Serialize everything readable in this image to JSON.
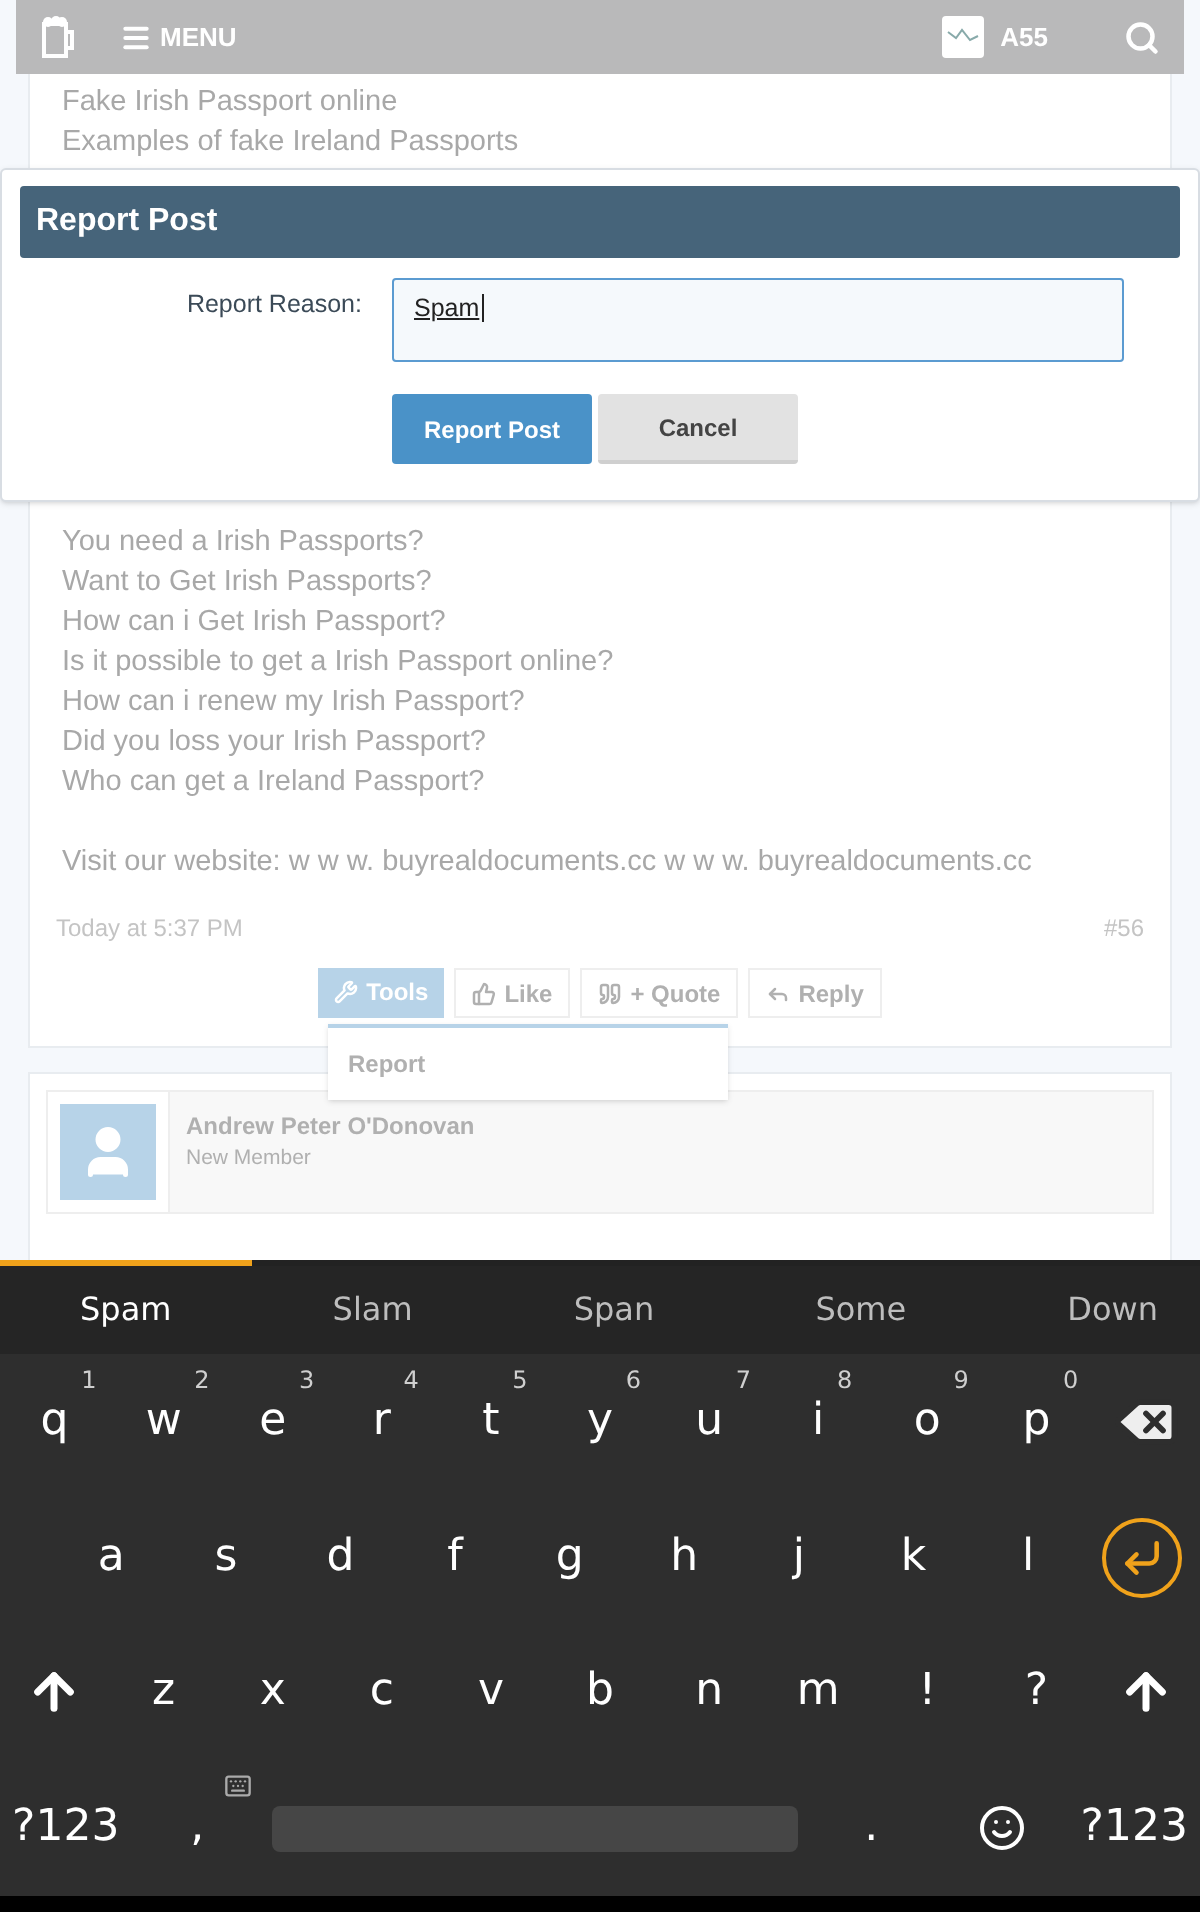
{
  "header": {
    "menu_label": "MENU",
    "username": "A55"
  },
  "post": {
    "lines_top": [
      "Fake Irish Passport online",
      "Examples of fake Ireland Passports"
    ],
    "lines": [
      "You need a Irish Passports?",
      "Want to Get Irish Passports?",
      "How can i Get Irish Passport?",
      "Is it possible to get a Irish Passport online?",
      "How can i renew my Irish Passport?",
      "Did you loss your Irish Passport?",
      "Who can get a Ireland Passport?"
    ],
    "website_line": "Visit our website: w w w. buyrealdocuments.cc w w w. buyrealdocuments.cc",
    "time": "Today at 5:37 PM",
    "number": "#56",
    "actions": [
      {
        "kind": "tools",
        "label": "Tools",
        "selected": true
      },
      {
        "kind": "like",
        "label": "Like",
        "selected": false
      },
      {
        "kind": "quote",
        "label": "+ Quote",
        "selected": false
      },
      {
        "kind": "reply",
        "label": "Reply",
        "selected": false
      }
    ],
    "tools_menu": [
      "Report"
    ]
  },
  "next_post": {
    "author": "Andrew Peter O'Donovan",
    "role": "New Member"
  },
  "dialog": {
    "title": "Report Post",
    "field_label": "Report Reason:",
    "field_value": "Spam",
    "buttons": [
      {
        "kind": "primary",
        "label": "Report Post"
      },
      {
        "kind": "secondary",
        "label": "Cancel"
      }
    ]
  },
  "keyboard": {
    "level": 0.21,
    "suggestions": [
      {
        "label": "Spam",
        "selected": true
      },
      {
        "label": "Slam",
        "selected": false
      },
      {
        "label": "Span",
        "selected": false
      },
      {
        "label": "Some",
        "selected": false
      },
      {
        "label": "Down",
        "selected": false
      }
    ],
    "rows": [
      [
        {
          "kind": "key",
          "label": "q",
          "hint": "1"
        },
        {
          "kind": "key",
          "label": "w",
          "hint": "2"
        },
        {
          "kind": "key",
          "label": "e",
          "hint": "3"
        },
        {
          "kind": "key",
          "label": "r",
          "hint": "4"
        },
        {
          "kind": "key",
          "label": "t",
          "hint": "5"
        },
        {
          "kind": "key",
          "label": "y",
          "hint": "6"
        },
        {
          "kind": "key",
          "label": "u",
          "hint": "7"
        },
        {
          "kind": "key",
          "label": "i",
          "hint": "8"
        },
        {
          "kind": "key",
          "label": "o",
          "hint": "9"
        },
        {
          "kind": "key",
          "label": "p",
          "hint": "0"
        },
        {
          "kind": "backspace"
        }
      ],
      [
        {
          "kind": "key",
          "label": "a"
        },
        {
          "kind": "key",
          "label": "s"
        },
        {
          "kind": "key",
          "label": "d"
        },
        {
          "kind": "key",
          "label": "f"
        },
        {
          "kind": "key",
          "label": "g"
        },
        {
          "kind": "key",
          "label": "h"
        },
        {
          "kind": "key",
          "label": "j"
        },
        {
          "kind": "key",
          "label": "k"
        },
        {
          "kind": "key",
          "label": "l"
        },
        {
          "kind": "enter"
        }
      ],
      [
        {
          "kind": "shift"
        },
        {
          "kind": "key",
          "label": "z"
        },
        {
          "kind": "key",
          "label": "x"
        },
        {
          "kind": "key",
          "label": "c"
        },
        {
          "kind": "key",
          "label": "v"
        },
        {
          "kind": "key",
          "label": "b"
        },
        {
          "kind": "key",
          "label": "n"
        },
        {
          "kind": "key",
          "label": "m"
        },
        {
          "kind": "key",
          "label": "!"
        },
        {
          "kind": "key",
          "label": "?"
        },
        {
          "kind": "shift"
        }
      ],
      [
        {
          "kind": "key",
          "label": "?123"
        },
        {
          "kind": "comma",
          "label": ","
        },
        {
          "kind": "space"
        },
        {
          "kind": "key",
          "label": "."
        },
        {
          "kind": "emoji"
        },
        {
          "kind": "key",
          "label": "?123"
        }
      ]
    ]
  }
}
